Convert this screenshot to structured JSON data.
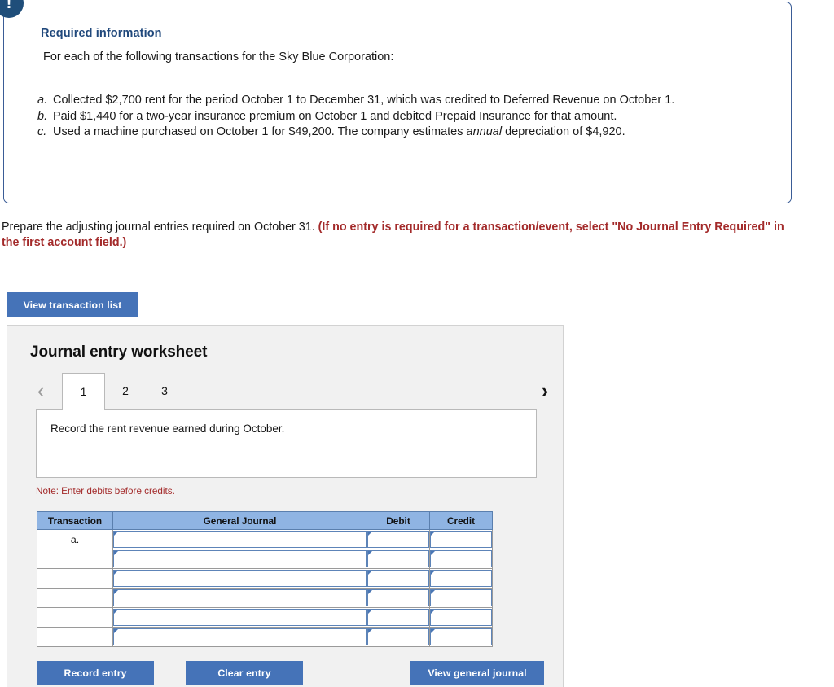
{
  "required_info": {
    "badge_icon": "exclamation-icon",
    "title": "Required information",
    "intro": "For each of the following transactions for the Sky Blue Corporation:",
    "items": [
      {
        "marker": "a.",
        "text_before": "Collected $2,700 rent for the period October 1 to December 31, which was credited to Deferred Revenue on October 1.",
        "emphasis": "",
        "text_after": ""
      },
      {
        "marker": "b.",
        "text_before": "Paid $1,440 for a two-year insurance premium on October 1 and debited Prepaid Insurance for that amount.",
        "emphasis": "",
        "text_after": ""
      },
      {
        "marker": "c.",
        "text_before": "Used a machine purchased on October 1 for $49,200. The company estimates ",
        "emphasis": "annual",
        "text_after": " depreciation of $4,920."
      }
    ]
  },
  "prepare": {
    "plain": "Prepare the adjusting journal entries required on October 31. ",
    "red": "(If no entry is required for a transaction/event, select \"No Journal Entry Required\" in the first account field.)"
  },
  "toolbar": {
    "view_transaction_list_label": "View transaction list"
  },
  "worksheet": {
    "title": "Journal entry worksheet",
    "prev_arrow": "‹",
    "next_arrow": "›",
    "tabs": [
      {
        "label": "1",
        "active": true
      },
      {
        "label": "2",
        "active": false
      },
      {
        "label": "3",
        "active": false
      }
    ],
    "prompt": "Record the rent revenue earned during October.",
    "note": "Note: Enter debits before credits.",
    "table": {
      "headers": [
        "Transaction",
        "General Journal",
        "Debit",
        "Credit"
      ],
      "rows": [
        {
          "transaction": "a.",
          "general_journal": "",
          "debit": "",
          "credit": ""
        },
        {
          "transaction": "",
          "general_journal": "",
          "debit": "",
          "credit": ""
        },
        {
          "transaction": "",
          "general_journal": "",
          "debit": "",
          "credit": ""
        },
        {
          "transaction": "",
          "general_journal": "",
          "debit": "",
          "credit": ""
        },
        {
          "transaction": "",
          "general_journal": "",
          "debit": "",
          "credit": ""
        },
        {
          "transaction": "",
          "general_journal": "",
          "debit": "",
          "credit": ""
        }
      ]
    },
    "buttons": {
      "record_entry": "Record entry",
      "clear_entry": "Clear entry",
      "view_general_journal": "View general journal"
    }
  },
  "colors": {
    "accent_blue": "#4573b8",
    "header_blue": "#8fb4e3",
    "panel_border": "#3a5c96",
    "badge_blue": "#1f4e7a",
    "heading_navy": "#21497c",
    "alert_red": "#a32a2a",
    "card_bg": "#f1f1f1"
  }
}
